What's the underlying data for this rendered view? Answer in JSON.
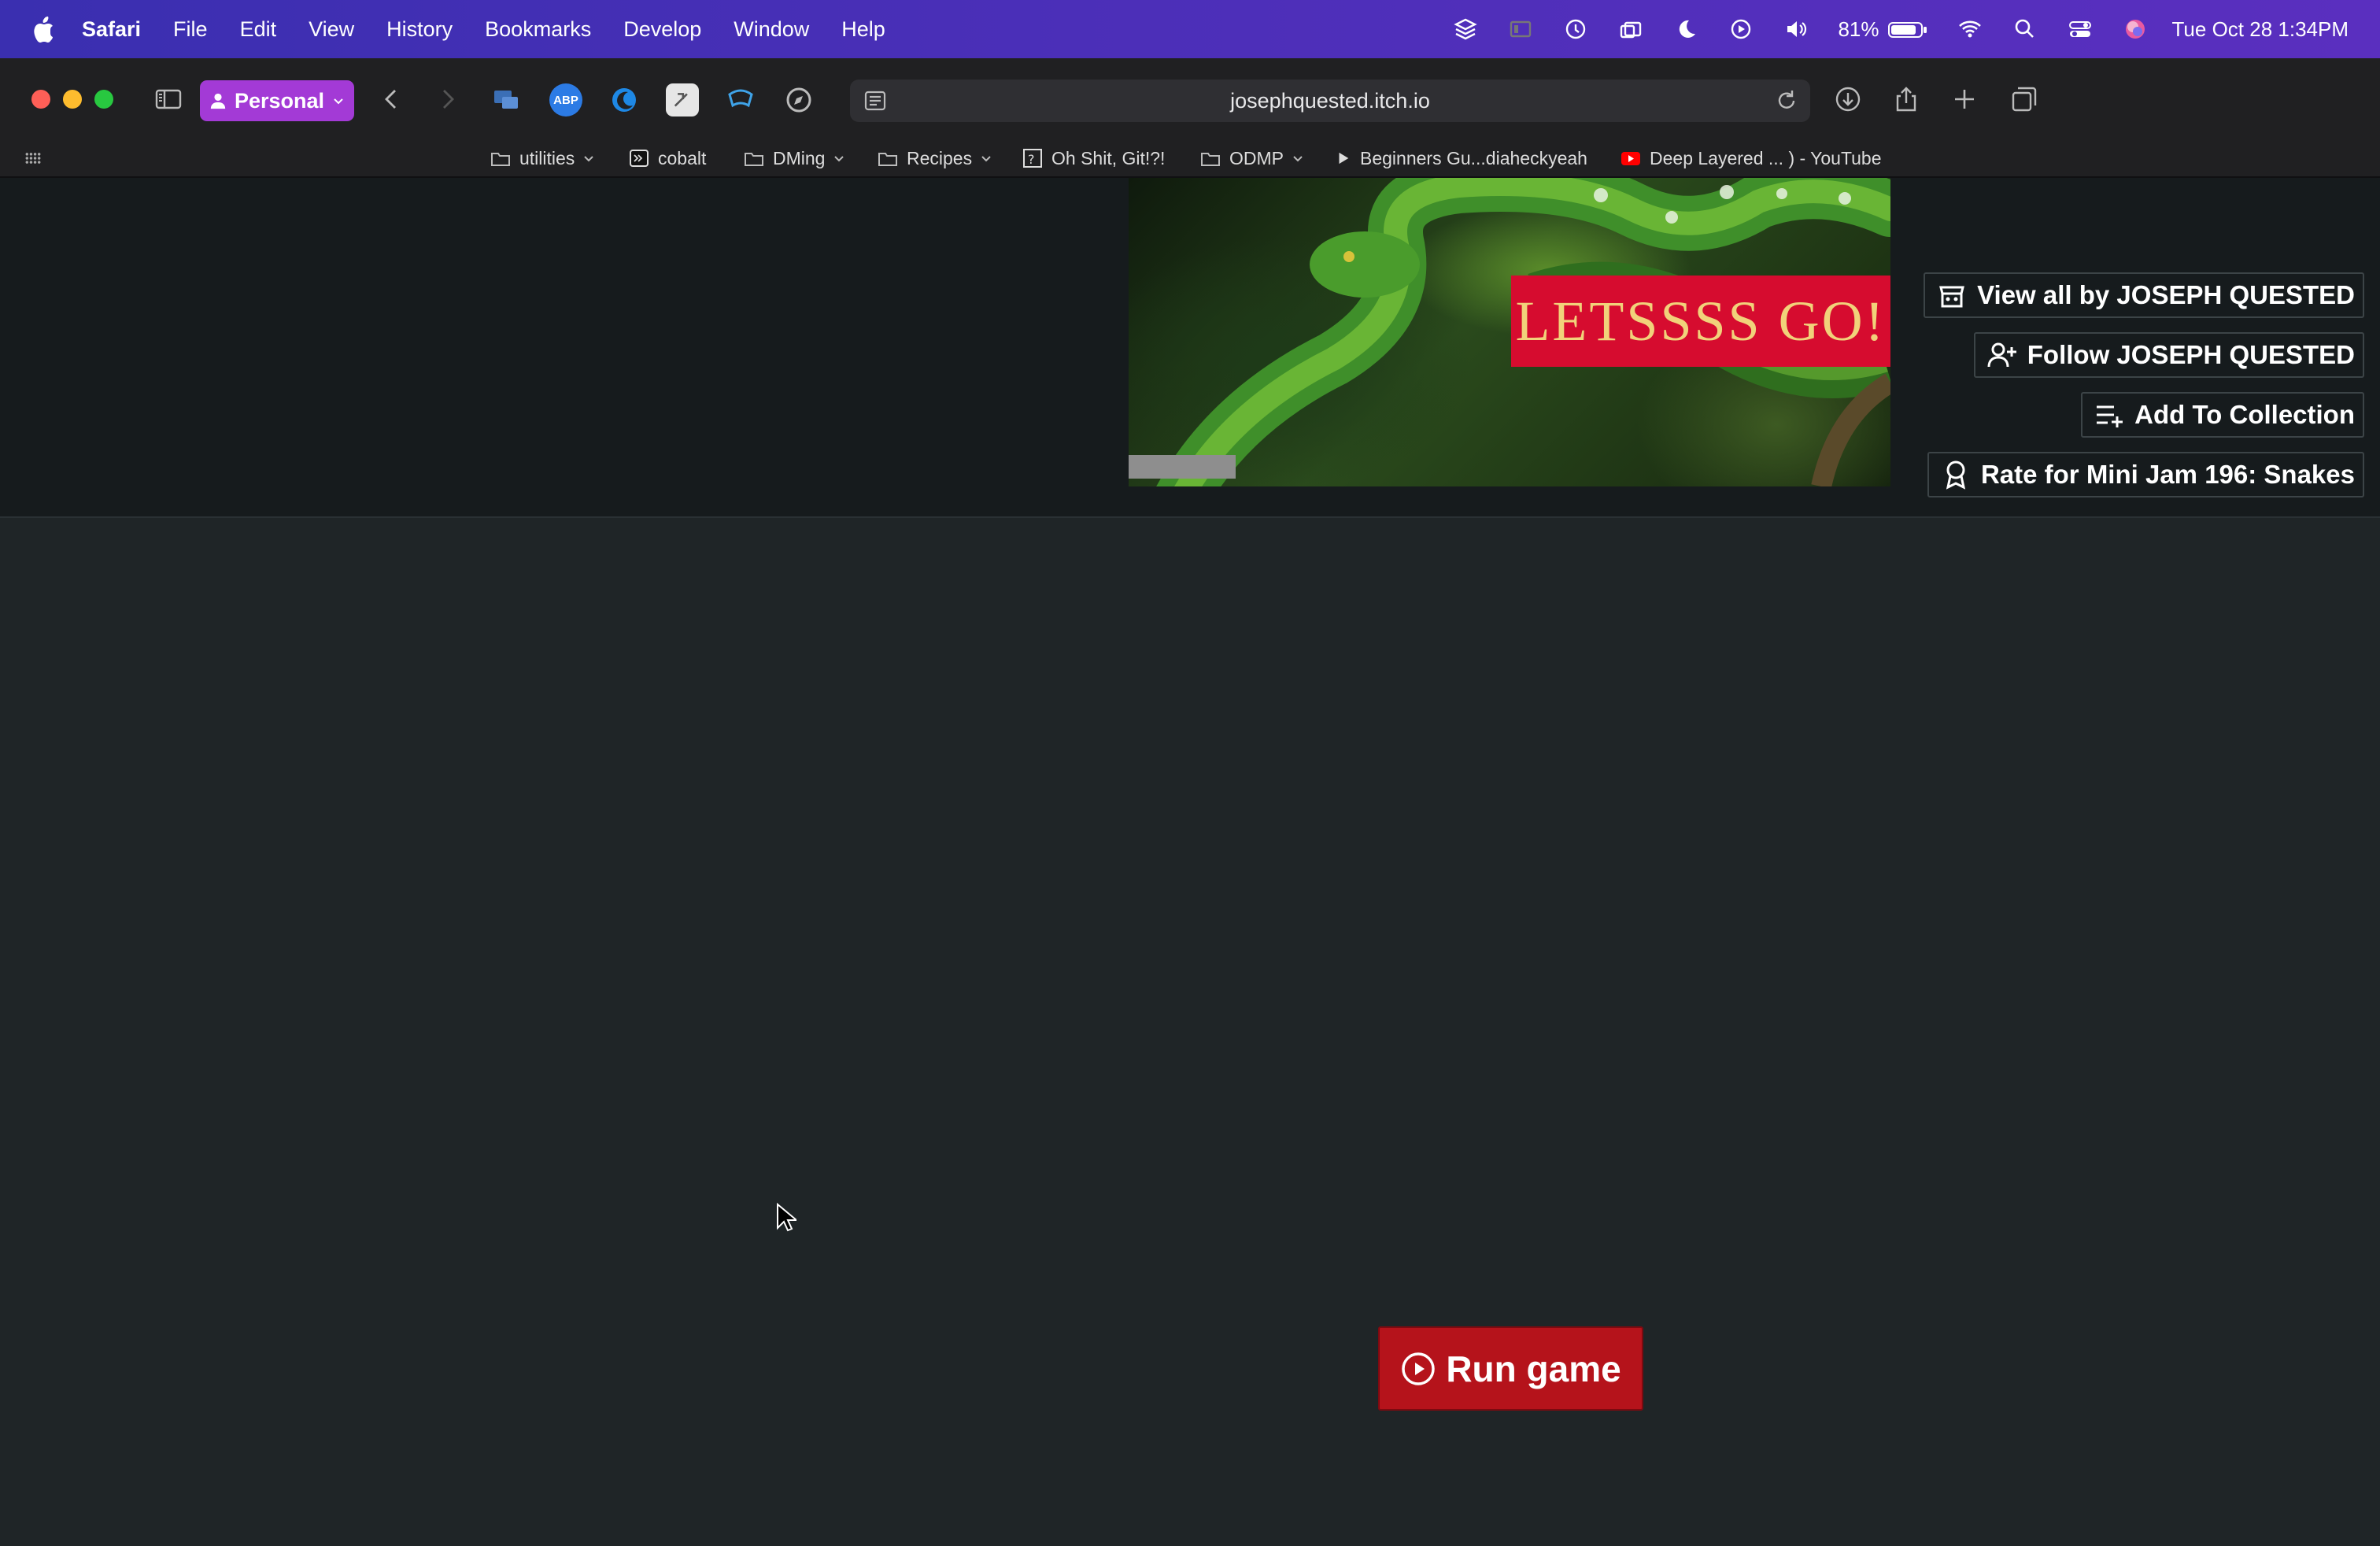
{
  "menubar": {
    "app": "Safari",
    "items": [
      "File",
      "Edit",
      "View",
      "History",
      "Bookmarks",
      "Develop",
      "Window",
      "Help"
    ],
    "battery": "81%",
    "clock": "Tue Oct 28  1:34PM"
  },
  "browser": {
    "profile": "Personal",
    "url": "josephquested.itch.io",
    "bookmarks": [
      {
        "label": "utilities",
        "icon": "folder-icon"
      },
      {
        "label": "cobalt",
        "icon": "terminal-icon"
      },
      {
        "label": "DMing",
        "icon": "folder-icon"
      },
      {
        "label": "Recipes",
        "icon": "folder-icon"
      },
      {
        "label": "Oh Shit, Git!?!",
        "icon": "site-icon"
      },
      {
        "label": "ODMP",
        "icon": "folder-icon"
      },
      {
        "label": "Beginners Gu...diaheckyeah",
        "icon": "play-icon"
      },
      {
        "label": "Deep Layered ... ) - YouTube",
        "icon": "youtube-icon"
      }
    ]
  },
  "page": {
    "banner_text": "LETSSSS GO!",
    "buttons": {
      "view_all": "View all by JOSEPH QUESTED",
      "follow": "Follow JOSEPH QUESTED",
      "add_collection": "Add To Collection",
      "rate": "Rate for Mini Jam 196: Snakes"
    },
    "run_game": "Run game"
  },
  "colors": {
    "menubar": "#4b2fb8",
    "profile": "#a33ad6",
    "run_button": "#b5131b",
    "banner_label": "#d60c2f",
    "page_bg": "#1f2527"
  }
}
